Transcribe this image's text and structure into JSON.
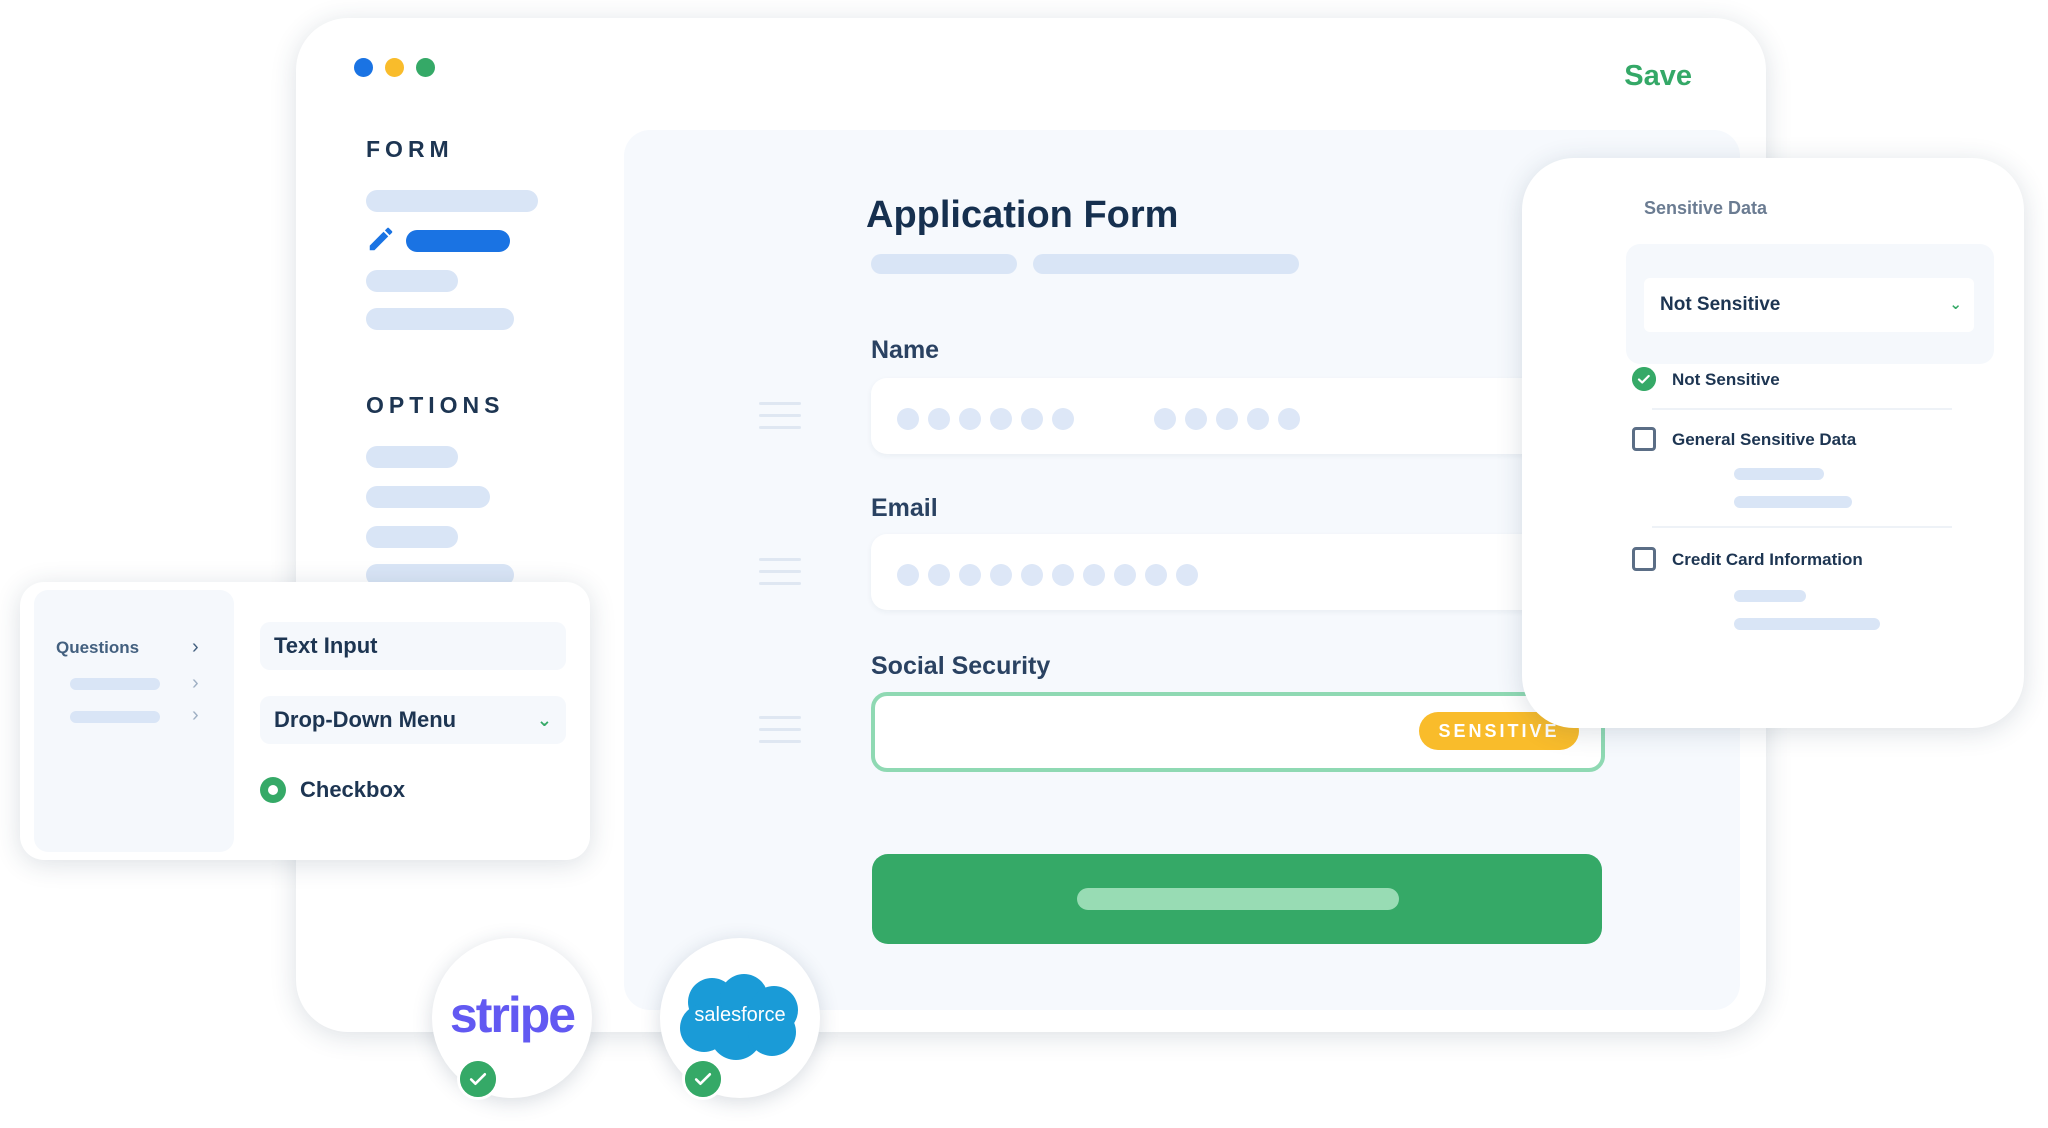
{
  "window": {
    "save_label": "Save",
    "dot_colors": [
      "#1a73e3",
      "#f9bc2b",
      "#35a967"
    ]
  },
  "sidebar": {
    "form_title": "FORM",
    "options_title": "OPTIONS"
  },
  "form": {
    "title": "Application Form",
    "fields": [
      {
        "label": "Name"
      },
      {
        "label": "Email"
      },
      {
        "label": "Social Security",
        "badge": "SENSITIVE"
      }
    ]
  },
  "questions_panel": {
    "label": "Questions",
    "text_input": "Text Input",
    "dropdown": "Drop-Down Menu",
    "checkbox": "Checkbox"
  },
  "sensitive_panel": {
    "title": "Sensitive Data",
    "selected": "Not Sensitive",
    "options": [
      {
        "label": "Not Sensitive",
        "checked": true
      },
      {
        "label": "General Sensitive Data",
        "checked": false
      },
      {
        "label": "Credit Card Information",
        "checked": false
      }
    ]
  },
  "integrations": [
    {
      "name": "stripe",
      "connected": true
    },
    {
      "name": "salesforce",
      "connected": true
    }
  ],
  "colors": {
    "primary": "#1a73e3",
    "success": "#35a967",
    "warning": "#f9bc2b"
  }
}
